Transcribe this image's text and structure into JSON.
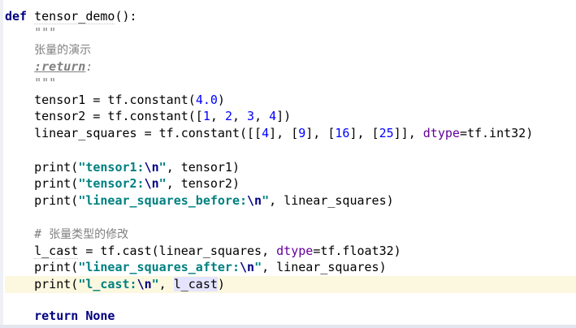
{
  "code": {
    "l1": {
      "kw": "def",
      "name": "tensor_demo",
      "rest": "():"
    },
    "l2": {
      "doc": "\"\"\""
    },
    "l3": {
      "doc_zh": "张量的演示"
    },
    "l4": {
      "tag": ":return",
      "colon": ":"
    },
    "l5": {
      "doc": "\"\"\""
    },
    "l6": {
      "a": "tensor1 = tf.constant(",
      "n": "4.0",
      "b": ")"
    },
    "l7": {
      "a": "tensor2 = tf.constant([",
      "n1": "1",
      "s1": ", ",
      "n2": "2",
      "s2": ", ",
      "n3": "3",
      "s3": ", ",
      "n4": "4",
      "b": "])"
    },
    "l8": {
      "a": "linear_squares = tf.constant([[",
      "n1": "4",
      "s1": "], [",
      "n2": "9",
      "s2": "], [",
      "n3": "16",
      "s3": "], [",
      "n4": "25",
      "s4": "]], ",
      "p": "dtype",
      "b": "=tf.int32)"
    },
    "l9": {
      "a": "print(",
      "s": "\"tensor1:",
      "e": "\\n",
      "q": "\"",
      "b": ", tensor1)"
    },
    "l10": {
      "a": "print(",
      "s": "\"tensor2:",
      "e": "\\n",
      "q": "\"",
      "b": ", tensor2)"
    },
    "l11": {
      "a": "print(",
      "s": "\"linear_squares_before:",
      "e": "\\n",
      "q": "\"",
      "b": ", linear_squares)"
    },
    "l12": {
      "hash": "# ",
      "zh": "张量类型的修改"
    },
    "l13": {
      "v": "l_cast",
      "a": " = tf.cast(linear_squares, ",
      "p": "dtype",
      "b": "=tf.float32)"
    },
    "l14": {
      "a": "print(",
      "s": "\"linear_squares_after:",
      "e": "\\n",
      "q": "\"",
      "b": ", linear_squares)"
    },
    "l15": {
      "a": "print(",
      "s": "\"l_cast:",
      "e": "\\n",
      "q": "\"",
      "c": ", ",
      "v": "l_cast",
      "b": ")"
    },
    "l16": {
      "kw": "return",
      "sp": " ",
      "none": "None"
    }
  },
  "colors": {
    "keyword": "#000080",
    "string": "#008080",
    "number": "#0000ff",
    "comment": "#808080",
    "param": "#660099",
    "current_line": "#fcf8e0"
  }
}
